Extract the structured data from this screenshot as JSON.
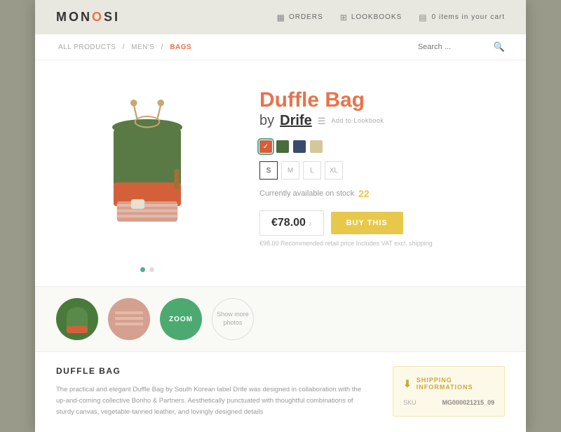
{
  "header": {
    "logo_text": "MONOSI",
    "logo_accent": "O",
    "nav_orders": "ORDERS",
    "nav_lookbooks": "LOOKBOOKS",
    "cart_text": "0 items in your cart"
  },
  "breadcrumb": {
    "all_products": "ALL PRODUCTS",
    "mens": "MEN'S",
    "bags": "BAGS"
  },
  "search": {
    "placeholder": "Search ..."
  },
  "product": {
    "title": "Duffle Bag",
    "by_label": "by",
    "brand": "Drife",
    "lookbook_label": "Add to\nLookbook",
    "colors": [
      "#e8734a",
      "#4a6b3a",
      "#3a4a6b",
      "#d4c89a"
    ],
    "sizes": [
      "S",
      "M",
      "L",
      "XL"
    ],
    "stock_label": "Currently available on stock",
    "stock_count": "22",
    "price": "€78.00",
    "buy_label": "BUY THIS",
    "price_note": "€98.00 Recommended retail price\nIncludes VAT excl. shipping"
  },
  "thumbnails": {
    "zoom_label": "ZOOM",
    "more_photos_label": "Show more\nphotos"
  },
  "description": {
    "title": "DUFFLE BAG",
    "text": "The practical and elegant Duffle Bag by South Korean label Drife was designed in collaboration with the up-and-coming collective Bonho & Partners. Aesthetically punctuated with thoughtful combinations of sturdy canvas, vegetable-tanned leather, and lovingly designed details"
  },
  "shipping": {
    "title": "SHIPPING INFORMATIONS",
    "sku_label": "SKU",
    "sku_value": "MG000021215_09"
  },
  "dots": {
    "active_index": 0
  }
}
